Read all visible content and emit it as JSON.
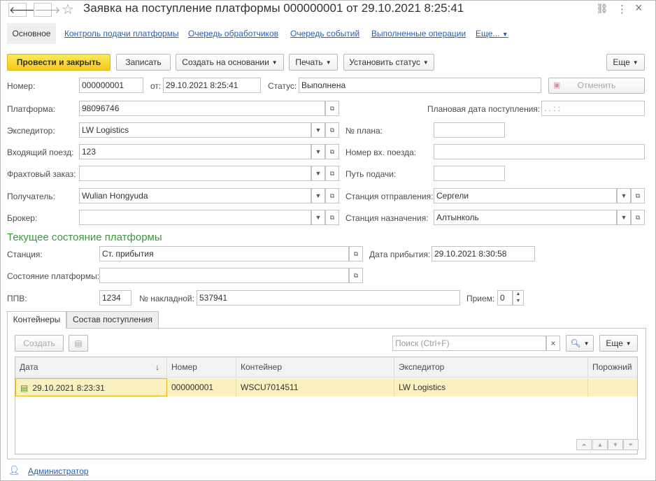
{
  "window": {
    "title": "Заявка на поступление платформы 000000001 от 29.10.2021 8:25:41",
    "nav_back": "🡐",
    "nav_forward": "🡒",
    "icons": {
      "link": "⛓",
      "more": "⋮",
      "close": "×",
      "star": "☆"
    }
  },
  "nav_tabs": [
    "Основное",
    "Контроль подачи платформы",
    "Очередь обработчиков",
    "Очередь событий",
    "Выполненные операции",
    "Еще..."
  ],
  "toolbar": {
    "post_close": "Провести и закрыть",
    "save": "Записать",
    "create_based": "Создать на основании",
    "print": "Печать",
    "set_status": "Установить статус",
    "more": "Еще"
  },
  "form": {
    "number_label": "Номер:",
    "number": "000000001",
    "date_label": "от:",
    "date": "29.10.2021  8:25:41",
    "status_label": "Статус:",
    "status": "Выполнена",
    "cancel_button": "Отменить",
    "platform_label": "Платформа:",
    "platform": "98096746",
    "planned_date_label": "Плановая дата поступления:",
    "planned_date": " .  .         :  :",
    "forwarder_label": "Экспедитор:",
    "forwarder": "LW Logistics",
    "plan_no_label": "№ плана:",
    "plan_no": "",
    "incoming_train_label": "Входящий поезд:",
    "incoming_train": "123",
    "incoming_train_no_label": "Номер вх. поезда:",
    "incoming_train_no": "",
    "freight_order_label": "Фрахтовый заказ:",
    "freight_order": "",
    "track_label": "Путь подачи:",
    "track": "",
    "recipient_label": "Получатель:",
    "recipient": "Wulian Hongyuda",
    "departure_station_label": "Станция отправления:",
    "departure_station": "Сергели",
    "broker_label": "Брокер:",
    "broker": "",
    "destination_station_label": "Станция назначения:",
    "destination_station": "Алтынколь"
  },
  "current_state": {
    "heading": "Текущее состояние платформы",
    "station_label": "Станция:",
    "station": "Ст. прибытия",
    "arrival_date_label": "Дата прибытия:",
    "arrival_date": "29.10.2021  8:30:58",
    "platform_state_label": "Состояние платформы:",
    "platform_state": "",
    "ppv_label": "ППВ:",
    "ppv": "1234",
    "waybill_label": "№ накладной:",
    "waybill": "537941",
    "reception_label": "Прием:",
    "reception": "0"
  },
  "tabs": [
    "Контейнеры",
    "Состав поступления"
  ],
  "containers": {
    "create": "Создать",
    "search_placeholder": "Поиск (Ctrl+F)",
    "more": "Еще",
    "columns": [
      "Дата",
      "Номер",
      "Контейнер",
      "Экспедитор",
      "Порожний"
    ],
    "sort_indicator": "↓",
    "rows": [
      {
        "date": "29.10.2021 8:23:31",
        "number": "000000001",
        "container": "WSCU7014511",
        "forwarder": "LW Logistics",
        "empty": ""
      }
    ]
  },
  "footer": {
    "user": "Администратор"
  }
}
